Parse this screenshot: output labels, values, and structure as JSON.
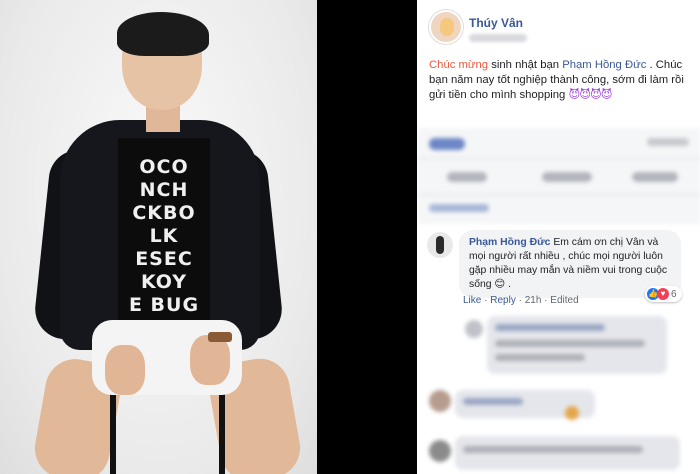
{
  "post": {
    "author": "Thúy Vân",
    "text_highlight": "Chúc mừng",
    "text_mid": " sinh nhật bạn ",
    "tagged_user": "Phạm Hồng Đức",
    "text_rest": " . Chúc bạn năm nay tốt nghiệp thành công, sớm đi làm rồi gửi tiền cho mình shopping ",
    "emoji": "😈😈😈😈"
  },
  "comment": {
    "author": "Phạm Hồng Đức",
    "text": "Em cám ơn chị Vân và mọi người rất nhiều , chúc mọi người luôn gặp nhiều may mắn và niềm vui trong cuộc sống 😊 .",
    "reaction_count": "6",
    "actions": {
      "like": "Like",
      "sep1": " · ",
      "reply": "Reply",
      "sep2": " · ",
      "time": "21h",
      "sep3": " · ",
      "edited": "Edited"
    }
  },
  "photo": {
    "shirt_text": "OCO\nNCH\nCKBO\nLK\nESEC\nKOY\nE BUG\nE OR"
  },
  "colors": {
    "link_blue": "#385898",
    "highlight_red": "#e9593f",
    "like_blue": "#1877f2",
    "heart_red": "#f33e58"
  },
  "icons": [
    "like-reaction-icon",
    "heart-reaction-icon"
  ]
}
